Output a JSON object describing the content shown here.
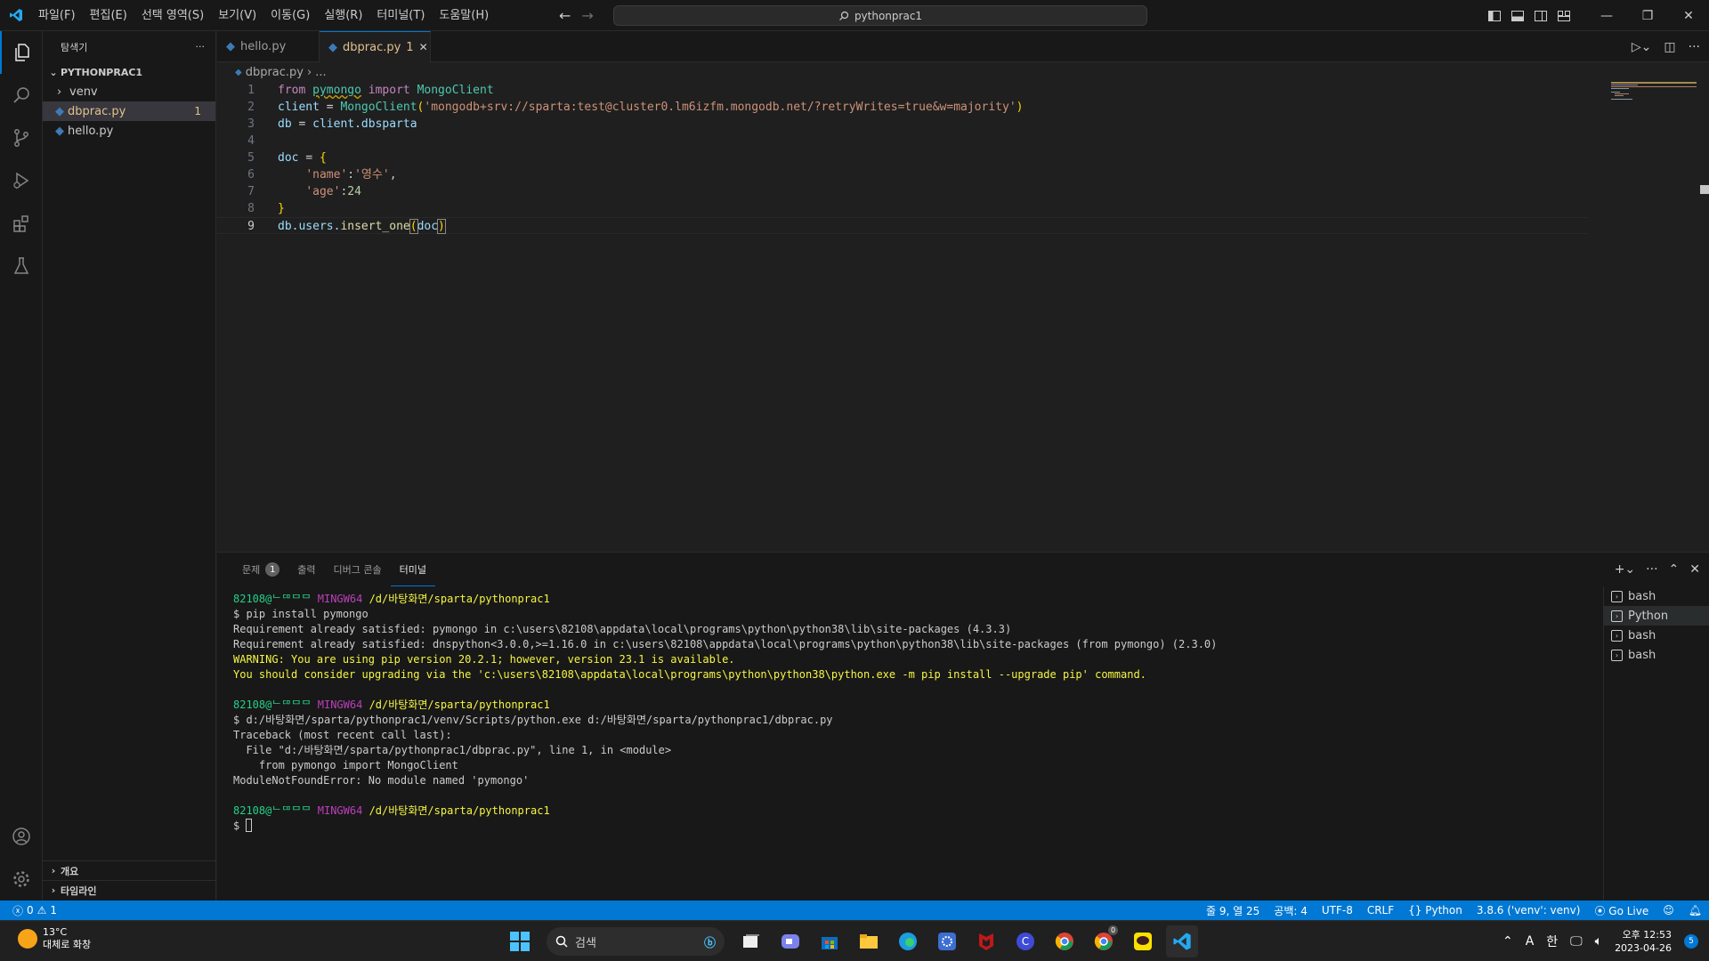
{
  "titlebar": {
    "menu": [
      "파일(F)",
      "편집(E)",
      "선택 영역(S)",
      "보기(V)",
      "이동(G)",
      "실행(R)",
      "터미널(T)",
      "도움말(H)"
    ],
    "search_text": "pythonprac1"
  },
  "sidebar": {
    "title": "탐색기",
    "folder": "PYTHONPRAC1",
    "items": [
      {
        "label": "venv",
        "type": "folder"
      },
      {
        "label": "dbprac.py",
        "type": "file",
        "badge": "1"
      },
      {
        "label": "hello.py",
        "type": "file"
      }
    ],
    "outline": "개요",
    "timeline": "타임라인"
  },
  "tabs": [
    {
      "label": "hello.py"
    },
    {
      "label": "dbprac.py",
      "badge": "1"
    }
  ],
  "breadcrumb": {
    "file": "dbprac.py",
    "rest": "..."
  },
  "editor": {
    "line_numbers": [
      "1",
      "2",
      "3",
      "4",
      "5",
      "6",
      "7",
      "8",
      "9"
    ],
    "lines": [
      "from pymongo import MongoClient",
      "client = MongoClient('mongodb+srv://sparta:test@cluster0.lm6izfm.mongodb.net/?retryWrites=true&w=majority')",
      "db = client.dbsparta",
      "",
      "doc = {",
      "    'name':'영수',",
      "    'age':24",
      "}",
      "db.users.insert_one(doc)"
    ]
  },
  "panel": {
    "tabs": [
      "문제",
      "출력",
      "디버그 콘솔",
      "터미널"
    ],
    "problems_count": "1",
    "terminal_lines": [
      {
        "user": "82108@ᄂᄃᄆᄆᄆ",
        "sys": "MINGW64",
        "path": "/d/바탕화면/sparta/pythonprac1"
      },
      {
        "text": "$ pip install pymongo"
      },
      {
        "text": "Requirement already satisfied: pymongo in c:\\users\\82108\\appdata\\local\\programs\\python\\python38\\lib\\site-packages (4.3.3)"
      },
      {
        "text": "Requirement already satisfied: dnspython<3.0.0,>=1.16.0 in c:\\users\\82108\\appdata\\local\\programs\\python\\python38\\lib\\site-packages (from pymongo) (2.3.0)"
      },
      {
        "warn": "WARNING: You are using pip version 20.2.1; however, version 23.1 is available."
      },
      {
        "warn": "You should consider upgrading via the 'c:\\users\\82108\\appdata\\local\\programs\\python\\python38\\python.exe -m pip install --upgrade pip' command."
      },
      {
        "text": ""
      },
      {
        "user": "82108@ᄂᄃᄆᄆᄆ",
        "sys": "MINGW64",
        "path": "/d/바탕화면/sparta/pythonprac1"
      },
      {
        "text": "$ d:/바탕화면/sparta/pythonprac1/venv/Scripts/python.exe d:/바탕화면/sparta/pythonprac1/dbprac.py"
      },
      {
        "text": "Traceback (most recent call last):"
      },
      {
        "text": "  File \"d:/바탕화면/sparta/pythonprac1/dbprac.py\", line 1, in <module>"
      },
      {
        "text": "    from pymongo import MongoClient"
      },
      {
        "text": "ModuleNotFoundError: No module named 'pymongo'"
      },
      {
        "text": ""
      },
      {
        "user": "82108@ᄂᄃᄆᄆᄆ",
        "sys": "MINGW64",
        "path": "/d/바탕화면/sparta/pythonprac1"
      },
      {
        "prompt": "$ "
      }
    ],
    "terminals": [
      "bash",
      "Python",
      "bash",
      "bash"
    ]
  },
  "statusbar": {
    "errors": "0",
    "warnings": "1",
    "position": "줄 9, 열 25",
    "spaces": "공백: 4",
    "encoding": "UTF-8",
    "eol": "CRLF",
    "language": "Python",
    "interpreter": "3.8.6 ('venv': venv)",
    "golive": "Go Live"
  },
  "taskbar": {
    "weather_temp": "13°C",
    "weather_desc": "대체로 화창",
    "search_label": "검색",
    "ime_a": "A",
    "ime_ko": "한",
    "time": "오후 12:53",
    "date": "2023-04-26",
    "notif_count": "5",
    "chrome_badge": "0"
  },
  "colors": {
    "accent": "#0078d4",
    "statusbar": "#0078d4",
    "warning": "#e2c08d"
  }
}
